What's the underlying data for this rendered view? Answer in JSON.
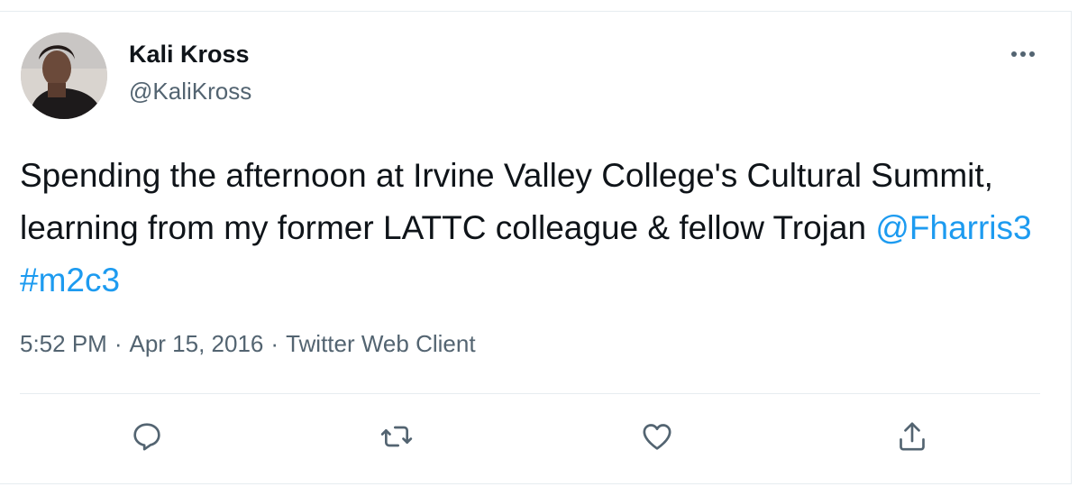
{
  "tweet": {
    "author": {
      "display_name": "Kali Kross",
      "handle": "@KaliKross"
    },
    "text_parts": [
      "Spending the afternoon at Irvine Valley College's Cultural Summit, learning from my former LATTC colleague & fellow Trojan ",
      "@Fharris3",
      " ",
      "#m2c3"
    ],
    "time": "5:52 PM",
    "date": "Apr 15, 2016",
    "source": "Twitter Web Client",
    "separator": "·"
  },
  "icons": {
    "more": "more-horizontal-icon",
    "reply": "reply-icon",
    "retweet": "retweet-icon",
    "like": "heart-icon",
    "share": "share-icon"
  },
  "colors": {
    "link": "#1d9bf0",
    "text": "#0f1419",
    "secondary": "#536471",
    "divider": "#e6ecf0"
  }
}
